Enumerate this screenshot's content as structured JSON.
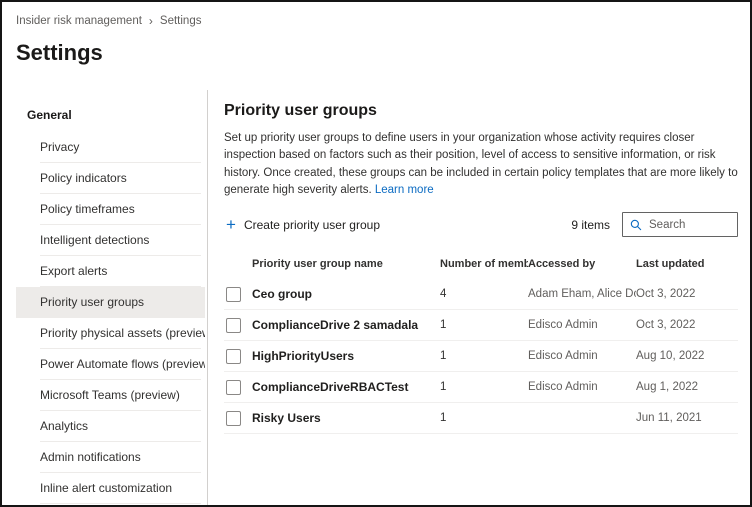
{
  "colors": {
    "accent": "#0b6bc2",
    "selected_bg": "#edebe9"
  },
  "icons": {
    "breadcrumb_chevron": "›",
    "plus": "+",
    "search": "magnifier-icon"
  },
  "breadcrumb": {
    "items": [
      "Insider risk management",
      "Settings"
    ]
  },
  "page_title": "Settings",
  "sidebar": {
    "section_label": "General",
    "items": [
      {
        "label": "Privacy",
        "selected": false
      },
      {
        "label": "Policy indicators",
        "selected": false
      },
      {
        "label": "Policy timeframes",
        "selected": false
      },
      {
        "label": "Intelligent detections",
        "selected": false
      },
      {
        "label": "Export alerts",
        "selected": false
      },
      {
        "label": "Priority user groups",
        "selected": true
      },
      {
        "label": "Priority physical assets (preview)",
        "selected": false
      },
      {
        "label": "Power Automate flows (preview)",
        "selected": false
      },
      {
        "label": "Microsoft Teams (preview)",
        "selected": false
      },
      {
        "label": "Analytics",
        "selected": false
      },
      {
        "label": "Admin notifications",
        "selected": false
      },
      {
        "label": "Inline alert customization",
        "selected": false
      }
    ]
  },
  "main": {
    "heading": "Priority user groups",
    "description": "Set up priority user groups to define users in your organization whose activity requires closer inspection based on factors such as their position, level of access to sensitive information, or risk history. Once created, these groups can be included in certain policy templates that are more likely to generate high severity alerts.",
    "learn_more": "Learn more",
    "toolbar": {
      "create_label": "Create priority user group",
      "items_count": "9 items",
      "search_placeholder": "Search"
    },
    "table": {
      "columns": [
        "Priority user group name",
        "Number of memb…",
        "Accessed by",
        "Last updated"
      ],
      "rows": [
        {
          "name": "Ceo group",
          "members": "4",
          "accessed_by": "Adam Eham, Alice Doe",
          "last_updated": "Oct 3, 2022"
        },
        {
          "name": "ComplianceDrive 2 samadala",
          "members": "1",
          "accessed_by": "Edisco Admin",
          "last_updated": "Oct 3, 2022"
        },
        {
          "name": "HighPriorityUsers",
          "members": "1",
          "accessed_by": "Edisco Admin",
          "last_updated": "Aug 10, 2022"
        },
        {
          "name": "ComplianceDriveRBACTest",
          "members": "1",
          "accessed_by": "Edisco Admin",
          "last_updated": "Aug 1, 2022"
        },
        {
          "name": "Risky Users",
          "members": "1",
          "accessed_by": "",
          "last_updated": "Jun 11, 2021"
        }
      ]
    }
  }
}
